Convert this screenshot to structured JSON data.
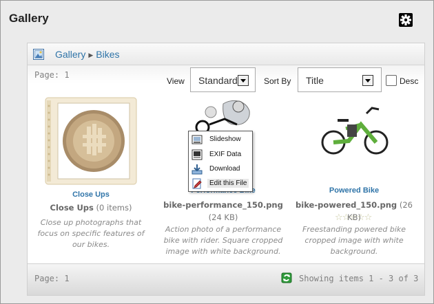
{
  "window": {
    "title": "Gallery",
    "gear_icon": "gear-icon"
  },
  "breadcrumb": {
    "root": "Gallery",
    "current": "Bikes"
  },
  "toolbar": {
    "page_label": "Page: 1",
    "view_label": "View",
    "view_value": "Standard",
    "sort_label": "Sort By",
    "sort_value": "Title",
    "desc_label": "Desc",
    "desc_checked": false
  },
  "items": [
    {
      "caption": "Close Ups",
      "title": "Close Ups",
      "meta": "(0 items)",
      "description": "Close up photographs that focus on specific features of our bikes."
    },
    {
      "caption": "Performance Bike",
      "title": "bike-performance_150.png",
      "meta": "(24 KB)",
      "description": "Action photo of a performance bike with rider. Square cropped image with white background."
    },
    {
      "caption": "Powered Bike",
      "title": "bike-powered_150.png",
      "meta": "(26 KB)",
      "description": "Freestanding powered bike cropped image with white background.",
      "rating": 0
    }
  ],
  "context_menu": {
    "items": [
      {
        "label": "Slideshow",
        "icon": "slideshow-icon"
      },
      {
        "label": "EXIF Data",
        "icon": "exif-icon"
      },
      {
        "label": "Download",
        "icon": "download-icon"
      },
      {
        "label": "Edit this File",
        "icon": "edit-file-icon"
      }
    ]
  },
  "footer": {
    "page_label": "Page: 1",
    "showing": "Showing items 1 - 3 of 3"
  },
  "colors": {
    "link": "#2f74a8",
    "muted": "#808080"
  }
}
